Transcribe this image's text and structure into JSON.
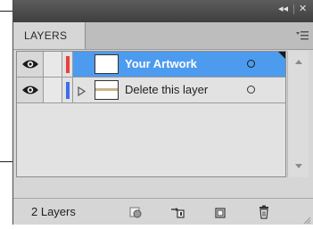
{
  "panel": {
    "title_controls": {
      "collapse": "◂◂",
      "close": "✕"
    },
    "tab": {
      "label": "LAYERS"
    },
    "menu_icon": "panel-menu-icon"
  },
  "layers": [
    {
      "name": "Your Artwork",
      "selected": true,
      "visible": true,
      "locked": false,
      "color": "#e8413a",
      "has_sublayers": false,
      "target_icon": "target-circle-icon"
    },
    {
      "name": "Delete this layer",
      "selected": false,
      "visible": true,
      "locked": false,
      "color": "#3b6fe8",
      "has_sublayers": true,
      "target_icon": "target-circle-icon"
    }
  ],
  "footer": {
    "count_label": "2 Layers",
    "buttons": [
      {
        "name": "make-clipping-mask-icon"
      },
      {
        "name": "create-sublayer-icon"
      },
      {
        "name": "create-new-layer-icon"
      },
      {
        "name": "delete-layer-icon"
      }
    ]
  },
  "colors": {
    "selection": "#4d9bee",
    "panel_bg": "#d6d6d6",
    "titlebar": "#4a4a4a"
  }
}
